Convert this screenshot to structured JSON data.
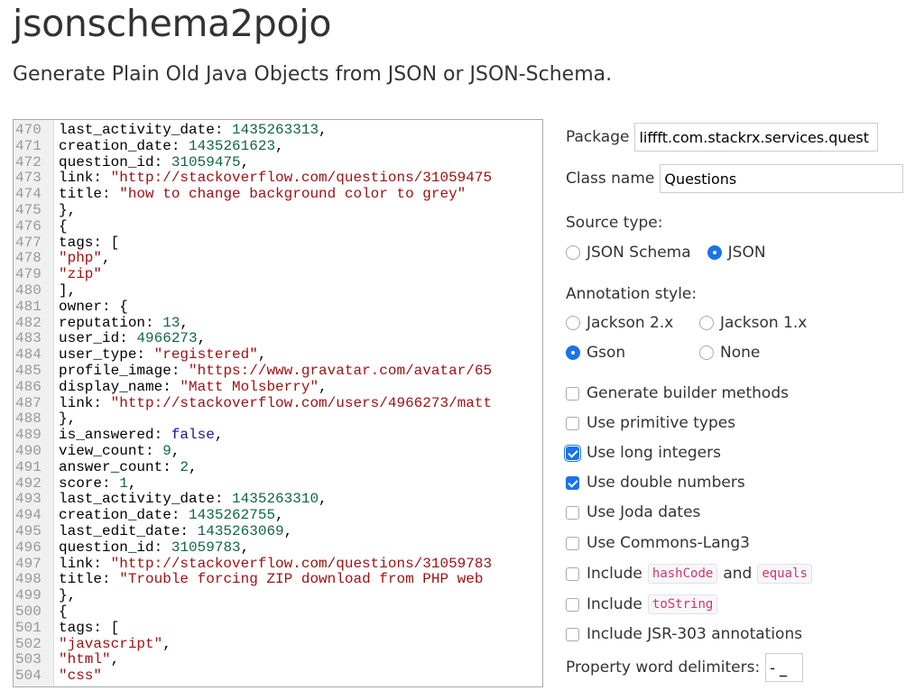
{
  "header": {
    "title": "jsonschema2pojo",
    "subtitle": "Generate Plain Old Java Objects from JSON or JSON-Schema."
  },
  "editor": {
    "lines": [
      {
        "n": "470",
        "parts": [
          {
            "t": "last_activity_date: "
          },
          {
            "t": "1435263313",
            "c": "num"
          },
          {
            "t": ","
          }
        ]
      },
      {
        "n": "471",
        "parts": [
          {
            "t": "creation_date: "
          },
          {
            "t": "1435261623",
            "c": "num"
          },
          {
            "t": ","
          }
        ]
      },
      {
        "n": "472",
        "parts": [
          {
            "t": "question_id: "
          },
          {
            "t": "31059475",
            "c": "num"
          },
          {
            "t": ","
          }
        ]
      },
      {
        "n": "473",
        "parts": [
          {
            "t": "link: "
          },
          {
            "t": "\"http://stackoverflow.com/questions/31059475",
            "c": "str"
          }
        ]
      },
      {
        "n": "474",
        "parts": [
          {
            "t": "title: "
          },
          {
            "t": "\"how to change background color to grey\"",
            "c": "str"
          }
        ]
      },
      {
        "n": "475",
        "parts": [
          {
            "t": "},"
          }
        ]
      },
      {
        "n": "476",
        "parts": [
          {
            "t": "{"
          }
        ]
      },
      {
        "n": "477",
        "parts": [
          {
            "t": "tags: ["
          }
        ]
      },
      {
        "n": "478",
        "parts": [
          {
            "t": "\"php\"",
            "c": "str"
          },
          {
            "t": ","
          }
        ]
      },
      {
        "n": "479",
        "parts": [
          {
            "t": "\"zip\"",
            "c": "str"
          }
        ]
      },
      {
        "n": "480",
        "parts": [
          {
            "t": "],"
          }
        ]
      },
      {
        "n": "481",
        "parts": [
          {
            "t": "owner: {"
          }
        ]
      },
      {
        "n": "482",
        "parts": [
          {
            "t": "reputation: "
          },
          {
            "t": "13",
            "c": "num"
          },
          {
            "t": ","
          }
        ]
      },
      {
        "n": "483",
        "parts": [
          {
            "t": "user_id: "
          },
          {
            "t": "4966273",
            "c": "num"
          },
          {
            "t": ","
          }
        ]
      },
      {
        "n": "484",
        "parts": [
          {
            "t": "user_type: "
          },
          {
            "t": "\"registered\"",
            "c": "str"
          },
          {
            "t": ","
          }
        ]
      },
      {
        "n": "485",
        "parts": [
          {
            "t": "profile_image: "
          },
          {
            "t": "\"https://www.gravatar.com/avatar/65",
            "c": "str"
          }
        ]
      },
      {
        "n": "486",
        "parts": [
          {
            "t": "display_name: "
          },
          {
            "t": "\"Matt Molsberry\"",
            "c": "str"
          },
          {
            "t": ","
          }
        ]
      },
      {
        "n": "487",
        "parts": [
          {
            "t": "link: "
          },
          {
            "t": "\"http://stackoverflow.com/users/4966273/matt",
            "c": "str"
          }
        ]
      },
      {
        "n": "488",
        "parts": [
          {
            "t": "},"
          }
        ]
      },
      {
        "n": "489",
        "parts": [
          {
            "t": "is_answered: "
          },
          {
            "t": "false",
            "c": "bool"
          },
          {
            "t": ","
          }
        ]
      },
      {
        "n": "490",
        "parts": [
          {
            "t": "view_count: "
          },
          {
            "t": "9",
            "c": "num"
          },
          {
            "t": ","
          }
        ]
      },
      {
        "n": "491",
        "parts": [
          {
            "t": "answer_count: "
          },
          {
            "t": "2",
            "c": "num"
          },
          {
            "t": ","
          }
        ]
      },
      {
        "n": "492",
        "parts": [
          {
            "t": "score: "
          },
          {
            "t": "1",
            "c": "num"
          },
          {
            "t": ","
          }
        ]
      },
      {
        "n": "493",
        "parts": [
          {
            "t": "last_activity_date: "
          },
          {
            "t": "1435263310",
            "c": "num"
          },
          {
            "t": ","
          }
        ]
      },
      {
        "n": "494",
        "parts": [
          {
            "t": "creation_date: "
          },
          {
            "t": "1435262755",
            "c": "num"
          },
          {
            "t": ","
          }
        ]
      },
      {
        "n": "495",
        "parts": [
          {
            "t": "last_edit_date: "
          },
          {
            "t": "1435263069",
            "c": "num"
          },
          {
            "t": ","
          }
        ]
      },
      {
        "n": "496",
        "parts": [
          {
            "t": "question_id: "
          },
          {
            "t": "31059783",
            "c": "num"
          },
          {
            "t": ","
          }
        ]
      },
      {
        "n": "497",
        "parts": [
          {
            "t": "link: "
          },
          {
            "t": "\"http://stackoverflow.com/questions/31059783",
            "c": "str"
          }
        ]
      },
      {
        "n": "498",
        "parts": [
          {
            "t": "title: "
          },
          {
            "t": "\"Trouble forcing ZIP download from PHP web",
            "c": "str"
          }
        ]
      },
      {
        "n": "499",
        "parts": [
          {
            "t": "},"
          }
        ]
      },
      {
        "n": "500",
        "parts": [
          {
            "t": "{"
          }
        ]
      },
      {
        "n": "501",
        "parts": [
          {
            "t": "tags: ["
          }
        ]
      },
      {
        "n": "502",
        "parts": [
          {
            "t": "\"javascript\"",
            "c": "str"
          },
          {
            "t": ","
          }
        ]
      },
      {
        "n": "503",
        "parts": [
          {
            "t": "\"html\"",
            "c": "str"
          },
          {
            "t": ","
          }
        ]
      },
      {
        "n": "504",
        "parts": [
          {
            "t": "\"css\"",
            "c": "str"
          }
        ]
      }
    ]
  },
  "options": {
    "package": {
      "label": "Package",
      "value": "liffft.com.stackrx.services.quest"
    },
    "class_name": {
      "label": "Class name",
      "value": "Questions"
    },
    "source_type": {
      "label": "Source type:",
      "json_schema": "JSON Schema",
      "json": "JSON",
      "selected": "json"
    },
    "annotation_style": {
      "label": "Annotation style:",
      "jackson2": "Jackson 2.x",
      "jackson1": "Jackson 1.x",
      "gson": "Gson",
      "none": "None",
      "selected": "gson"
    },
    "checkboxes": {
      "builder": {
        "label": "Generate builder methods",
        "checked": false
      },
      "primitive": {
        "label": "Use primitive types",
        "checked": false
      },
      "long_integers": {
        "label": "Use long integers",
        "checked": true
      },
      "double_numbers": {
        "label": "Use double numbers",
        "checked": true
      },
      "joda_dates": {
        "label": "Use Joda dates",
        "checked": false
      },
      "commons_lang3": {
        "label": "Use Commons-Lang3",
        "checked": false
      },
      "hashcode_equals": {
        "label_prefix": "Include",
        "code1": "hashCode",
        "conj": "and",
        "code2": "equals",
        "checked": false
      },
      "to_string": {
        "label_prefix": "Include",
        "code": "toString",
        "checked": false
      },
      "jsr303": {
        "label": "Include JSR-303 annotations",
        "checked": false
      }
    },
    "delimiters": {
      "label": "Property word delimiters:",
      "value": "- _"
    }
  }
}
